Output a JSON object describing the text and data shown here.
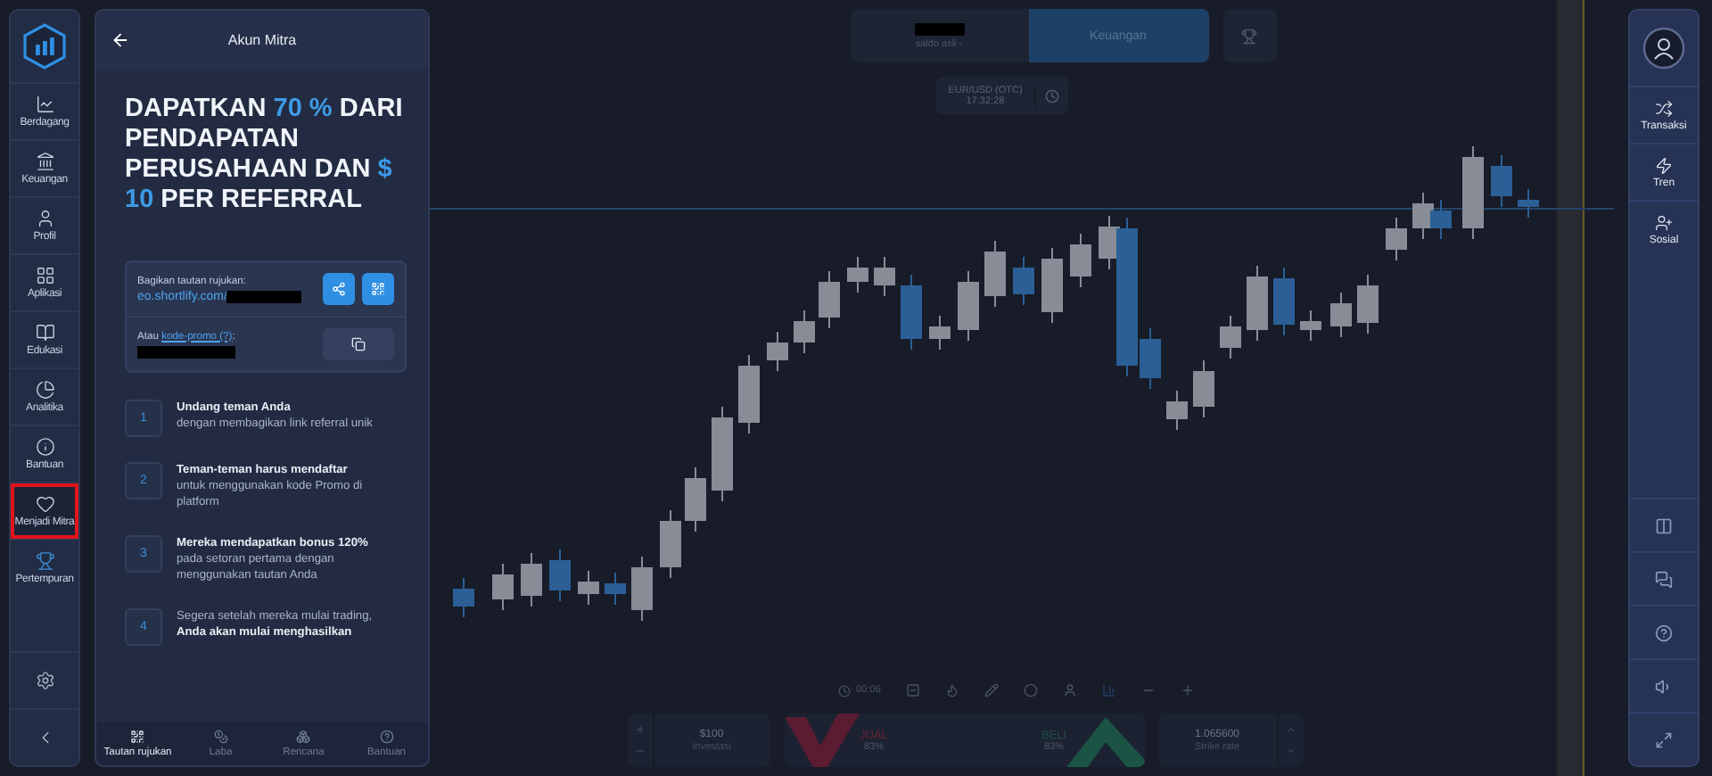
{
  "sidebar": {
    "items": [
      {
        "label": "Berdagang",
        "selected": false,
        "highlighted": false
      },
      {
        "label": "Keuangan",
        "selected": false,
        "highlighted": false
      },
      {
        "label": "Profil",
        "selected": false,
        "highlighted": false
      },
      {
        "label": "Aplikasi",
        "selected": false,
        "highlighted": false
      },
      {
        "label": "Edukasi",
        "selected": false,
        "highlighted": false
      },
      {
        "label": "Analitika",
        "selected": false,
        "highlighted": false
      },
      {
        "label": "Bantuan",
        "selected": false,
        "highlighted": false
      },
      {
        "label": "Menjadi Mitra",
        "selected": true,
        "highlighted": true
      },
      {
        "label": "Pertempuran",
        "selected": false,
        "highlighted": false
      }
    ]
  },
  "panel": {
    "title": "Akun Mitra",
    "headline": [
      {
        "text": "DAPATKAN",
        "accent": false
      },
      {
        "text": "70 %",
        "accent": true
      },
      {
        "text": "DARI PENDAPATAN PERUSAHAAN DAN",
        "accent": false
      },
      {
        "text": "$ 10",
        "accent": true
      },
      {
        "text": "PER REFERRAL",
        "accent": false
      }
    ],
    "share": {
      "label": "Bagikan tautan rujukan:",
      "link": "eo.shortlify.com/",
      "redacted": true
    },
    "promo": {
      "prefix": "Atau",
      "link": "kode-promo (?)",
      "suffix": ":",
      "redacted": true
    },
    "steps": [
      {
        "number": "1",
        "kind": "title_first",
        "title": "Undang teman Anda",
        "text": "dengan membagikan link referral unik"
      },
      {
        "number": "2",
        "kind": "title_first",
        "title": "Teman-teman harus mendaftar",
        "text": "untuk menggunakan kode Promo di platform"
      },
      {
        "number": "3",
        "kind": "title_first",
        "title": "Mereka mendapatkan bonus 120%",
        "text": "pada setoran pertama dengan menggunakan tautan Anda"
      },
      {
        "number": "4",
        "kind": "title_last",
        "title": "Anda akan mulai menghasilkan",
        "text": "Segera setelah mereka mulai trading,"
      }
    ],
    "tabs": [
      {
        "label": "Tautan rujukan",
        "selected": true
      },
      {
        "label": "Laba",
        "selected": false
      },
      {
        "label": "Rencana",
        "selected": false
      },
      {
        "label": "Bantuan",
        "selected": false
      }
    ]
  },
  "account": {
    "label": "saldo asli -",
    "redacted": true
  },
  "finance_button": "Keuangan",
  "asset": {
    "pair": "EUR/USD (OTC)",
    "time": "17:32:28"
  },
  "toolbar": {
    "timer": "00:06"
  },
  "trade": {
    "amount": "$100",
    "amount_label": "Investasi",
    "sell": "JUAL",
    "sell_payout": "83%",
    "buy": "BELI",
    "buy_payout": "83%",
    "strike": "1.065600",
    "strike_label": "Strike rate"
  },
  "right_sidebar": {
    "items": [
      {
        "label": "Transaksi"
      },
      {
        "label": "Tren"
      },
      {
        "label": "Sosial"
      }
    ]
  }
}
